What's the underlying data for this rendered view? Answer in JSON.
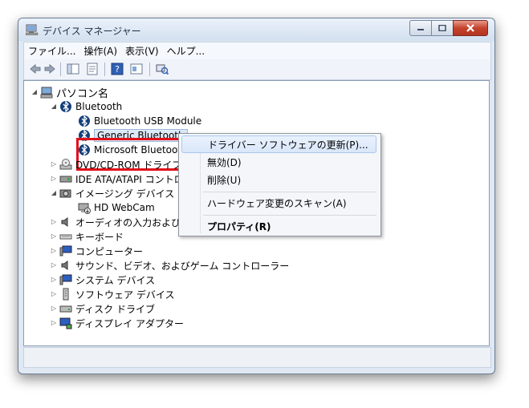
{
  "window": {
    "title": "デバイス マネージャー"
  },
  "menu": [
    {
      "label": "ファイル..."
    },
    {
      "label": "操作(A)"
    },
    {
      "label": "表示(V)"
    },
    {
      "label": "ヘルプ..."
    }
  ],
  "tree": {
    "root": "パソコン名",
    "bluetooth": {
      "label": "Bluetooth",
      "children": [
        {
          "label": "Bluetooth USB Module"
        },
        {
          "label": "Generic Bluetooth"
        },
        {
          "label": "Microsoft Bluetoot"
        }
      ]
    },
    "dvd": "DVD/CD-ROM ドライブ",
    "ide": "IDE ATA/ATAPI コントロ",
    "imaging": {
      "label": "イメージング デバイス",
      "child": "HD WebCam"
    },
    "audio_io": "オーディオの入力および出力",
    "keyboard": "キーボード",
    "computer": "コンピューター",
    "sound": "サウンド、ビデオ、およびゲーム コントローラー",
    "system": "システム デバイス",
    "software": "ソフトウェア デバイス",
    "disk": "ディスク ドライブ",
    "display": "ディスプレイ アダプター"
  },
  "context_menu": [
    {
      "label": "ドライバー ソフトウェアの更新(P)..."
    },
    {
      "label": "無効(D)"
    },
    {
      "label": "削除(U)"
    },
    {
      "label": "ハードウェア変更のスキャン(A)"
    },
    {
      "label": "プロパティ(R)"
    }
  ],
  "colors": {
    "highlight_box": "#e3101a",
    "selection": "#dfeaf8"
  }
}
